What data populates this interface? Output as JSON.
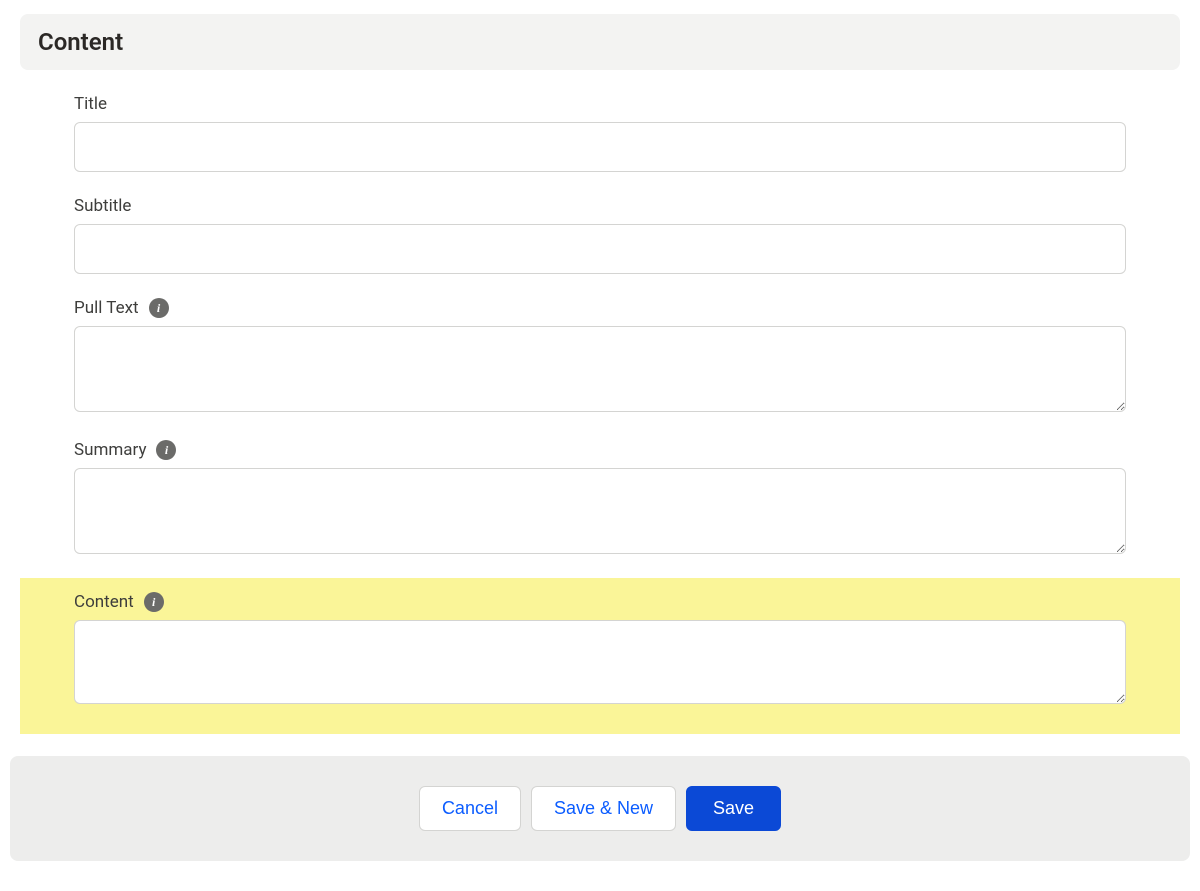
{
  "panel": {
    "header": "Content",
    "fields": {
      "title": {
        "label": "Title",
        "value": ""
      },
      "subtitle": {
        "label": "Subtitle",
        "value": ""
      },
      "pull_text": {
        "label": "Pull Text",
        "value": "",
        "has_info": true
      },
      "summary": {
        "label": "Summary",
        "value": "",
        "has_info": true
      },
      "content": {
        "label": "Content",
        "value": "",
        "has_info": true,
        "highlight": true
      }
    }
  },
  "footer": {
    "cancel": "Cancel",
    "save_new": "Save & New",
    "save": "Save"
  },
  "icons": {
    "info_glyph": "i"
  }
}
